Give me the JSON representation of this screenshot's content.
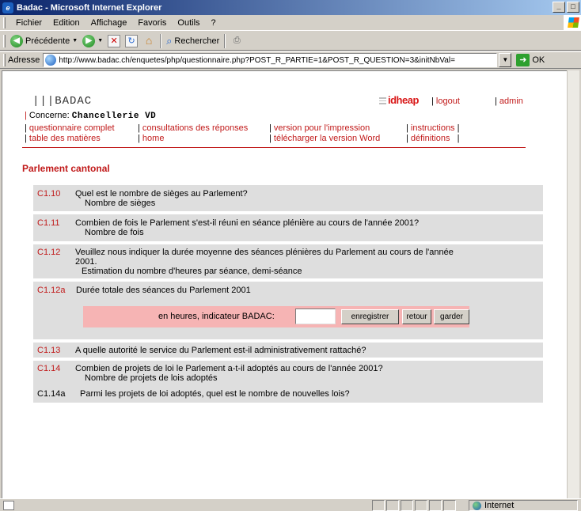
{
  "window": {
    "title": "Badac - Microsoft Internet Explorer",
    "minimize_glyph": "_",
    "maximize_glyph": "□"
  },
  "menu": [
    "Fichier",
    "Edition",
    "Affichage",
    "Favoris",
    "Outils",
    "?"
  ],
  "toolbar": {
    "back_label": "Précédente",
    "search_label": "Rechercher"
  },
  "address": {
    "label": "Adresse",
    "url": "http://www.badac.ch/enquetes/php/questionnaire.php?POST_R_PARTIE=1&POST_R_QUESTION=3&initNbVal=",
    "go_label": "OK"
  },
  "header": {
    "logo": "|||BADAC",
    "concerne_label": "Concerne:",
    "concerne_value": "Chancellerie VD",
    "brand": "idheap",
    "logout": "logout",
    "admin": "admin",
    "nav_col1": [
      "questionnaire complet",
      "table des matières"
    ],
    "nav_col2": [
      "consultations des réponses",
      "home"
    ],
    "nav_col3": [
      "version pour l'impression",
      "télécharger la version Word"
    ],
    "nav_col4": [
      "instructions",
      "définitions"
    ]
  },
  "section_title": "Parlement cantonal",
  "questions": [
    {
      "code": "C1.10",
      "text": "Quel est le nombre de sièges au Parlement?",
      "sub": "Nombre de sièges"
    },
    {
      "code": "C1.11",
      "text": "Combien de fois le Parlement s'est-il réuni en séance plénière au cours de l'année 2001?",
      "sub": "Nombre de fois"
    },
    {
      "code": "C1.12",
      "text_line1": "Veuillez nous indiquer la durée moyenne des séances plénières du Parlement au cours de l'année",
      "text_line2": "2001.",
      "sub": "Estimation du nombre d'heures par séance, demi-séance"
    },
    {
      "code": "C1.12a",
      "text": "Durée totale des séances du Parlement 2001"
    },
    {
      "code": "C1.13",
      "text": "A quelle autorité le service du Parlement est-il administrativement rattaché?"
    },
    {
      "code": "C1.14",
      "text": "Combien de projets de loi le Parlement a-t-il adoptés au cours de l'année 2001?",
      "sub": "Nombre de projets de lois adoptés"
    },
    {
      "code": "C1.14a",
      "text": "Parmi les projets de loi adoptés, quel est le nombre de nouvelles lois?"
    }
  ],
  "answer": {
    "label": "en heures, indicateur BADAC:",
    "value": "",
    "buttons": [
      "enregistrer",
      "retour",
      "garder"
    ]
  },
  "status": {
    "zone": "Internet"
  }
}
